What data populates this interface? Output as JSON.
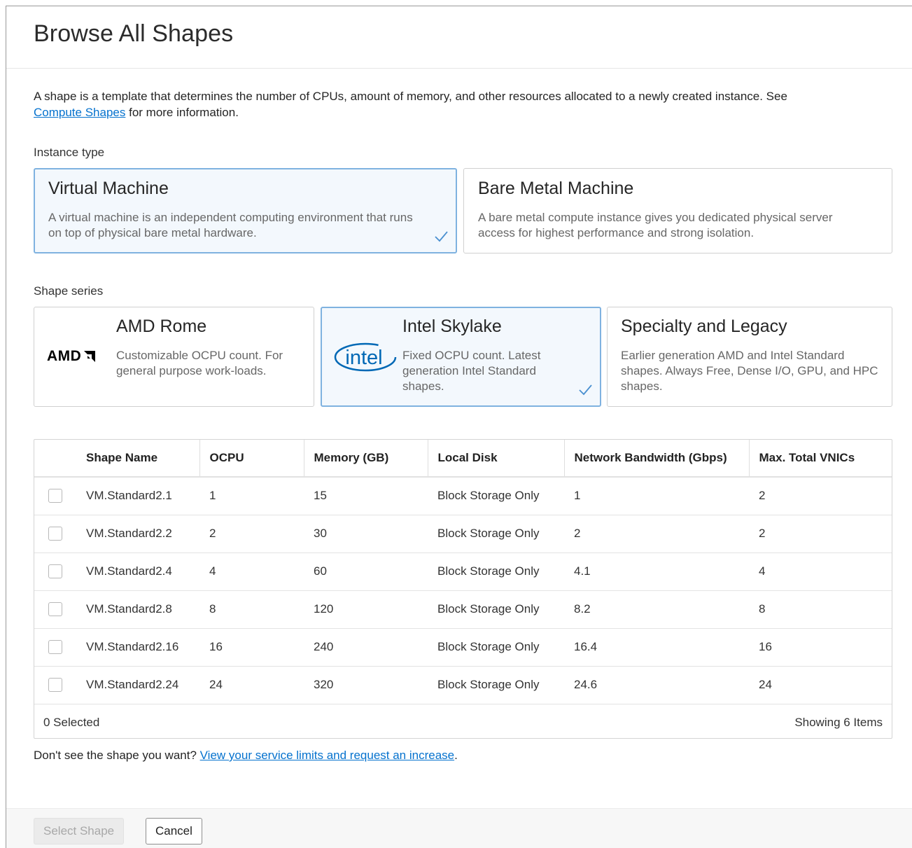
{
  "dialog": {
    "title": "Browse All Shapes",
    "intro_text": "A shape is a template that determines the number of CPUs, amount of memory, and other resources allocated to a newly created instance. See ",
    "intro_link": "Compute Shapes",
    "intro_suffix": " for more information."
  },
  "instance_type": {
    "label": "Instance type",
    "options": [
      {
        "title": "Virtual Machine",
        "description": "A virtual machine is an independent computing environment that runs on top of physical bare metal hardware.",
        "selected": true
      },
      {
        "title": "Bare Metal Machine",
        "description": "A bare metal compute instance gives you dedicated physical server access for highest performance and strong isolation.",
        "selected": false
      }
    ]
  },
  "shape_series": {
    "label": "Shape series",
    "options": [
      {
        "title": "AMD Rome",
        "logo_text": "AMD",
        "icon": "amd-logo",
        "description": "Customizable OCPU count. For general purpose work-loads.",
        "selected": false
      },
      {
        "title": "Intel Skylake",
        "logo_text": "intel",
        "icon": "intel-logo",
        "description": "Fixed OCPU count. Latest generation Intel Standard shapes.",
        "selected": true
      },
      {
        "title": "Specialty and Legacy",
        "description": "Earlier generation AMD and Intel Standard shapes. Always Free, Dense I/O, GPU, and HPC shapes.",
        "selected": false
      }
    ]
  },
  "table": {
    "columns": [
      "Shape Name",
      "OCPU",
      "Memory (GB)",
      "Local Disk",
      "Network Bandwidth (Gbps)",
      "Max. Total VNICs"
    ],
    "rows": [
      [
        "VM.Standard2.1",
        "1",
        "15",
        "Block Storage Only",
        "1",
        "2"
      ],
      [
        "VM.Standard2.2",
        "2",
        "30",
        "Block Storage Only",
        "2",
        "2"
      ],
      [
        "VM.Standard2.4",
        "4",
        "60",
        "Block Storage Only",
        "4.1",
        "4"
      ],
      [
        "VM.Standard2.8",
        "8",
        "120",
        "Block Storage Only",
        "8.2",
        "8"
      ],
      [
        "VM.Standard2.16",
        "16",
        "240",
        "Block Storage Only",
        "16.4",
        "16"
      ],
      [
        "VM.Standard2.24",
        "24",
        "320",
        "Block Storage Only",
        "24.6",
        "24"
      ]
    ],
    "selected_text": "0 Selected",
    "showing_text": "Showing 6 Items"
  },
  "hint": {
    "text": "Don't see the shape you want? ",
    "link": "View your service limits and request an increase",
    "suffix": "."
  },
  "footer": {
    "select_label": "Select Shape",
    "cancel_label": "Cancel"
  },
  "colors": {
    "link": "#0572ce",
    "selected_border": "#7fb2e0",
    "selected_bg": "#f3f8fd",
    "check": "#4a90d0",
    "intel_blue": "#0068b5"
  }
}
